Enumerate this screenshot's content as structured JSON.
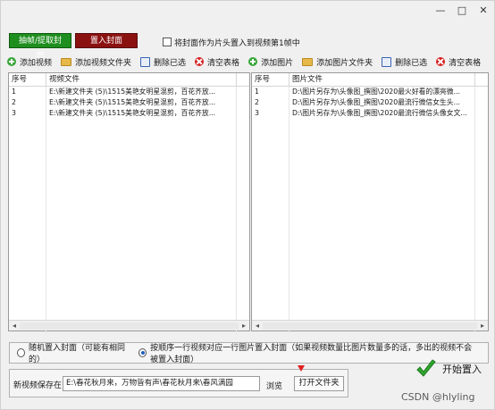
{
  "window": {
    "controls": {
      "minimize": "—",
      "maximize": "□",
      "close": "✕"
    }
  },
  "tabs": {
    "extract": "抽帧/提取封面",
    "place": "置入封面"
  },
  "options": {
    "first_frame_checkbox": "将封面作为片头置入到视频第1帧中"
  },
  "toolbar": {
    "left": [
      {
        "label": "添加视频",
        "icon": "add-icon"
      },
      {
        "label": "添加视频文件夹",
        "icon": "folder-icon"
      },
      {
        "label": "删除已选",
        "icon": "delete-icon"
      },
      {
        "label": "清空表格",
        "icon": "clear-icon"
      }
    ],
    "right": [
      {
        "label": "添加图片",
        "icon": "add-icon"
      },
      {
        "label": "添加图片文件夹",
        "icon": "folder-icon"
      },
      {
        "label": "删除已选",
        "icon": "delete-icon"
      },
      {
        "label": "清空表格",
        "icon": "clear-icon"
      }
    ]
  },
  "video_table": {
    "headers": {
      "no": "序号",
      "file": "视频文件"
    },
    "rows": [
      {
        "no": "1",
        "file": "E:\\新建文件夹 (5)\\1515美艳女明星混剪，百花齐放..."
      },
      {
        "no": "2",
        "file": "E:\\新建文件夹 (5)\\1515美艳女明星混剪，百花齐放..."
      },
      {
        "no": "3",
        "file": "E:\\新建文件夹 (5)\\1515美艳女明星混剪，百花齐放..."
      }
    ]
  },
  "image_table": {
    "headers": {
      "no": "序号",
      "file": "图片文件"
    },
    "rows": [
      {
        "no": "1",
        "file": "D:\\图片另存为\\头像图_撰图\\2020最火好看的漂亮微..."
      },
      {
        "no": "2",
        "file": "D:\\图片另存为\\头像图_撰图\\2020最流行微信女生头..."
      },
      {
        "no": "3",
        "file": "D:\\图片另存为\\头像图_撰图\\2020最流行微信头像女文..."
      }
    ]
  },
  "mode": {
    "random": "随机置入封面（可能有相同的）",
    "sequential": "按顺序一行视频对应一行图片置入封面（如果视频数量比图片数量多的话，多出的视频不会被置入封面）",
    "selected": "sequential"
  },
  "save": {
    "label": "新视频保存在:",
    "path": "E:\\春花秋月来，万物皆有声\\春花秋月来\\春风满园",
    "browse": "浏览",
    "open_folder": "打开文件夹"
  },
  "start": {
    "label": "开始置入"
  },
  "watermark": "CSDN @hlyling",
  "colors": {
    "extract_tab": "#1e8e1e",
    "place_tab": "#8b1111",
    "start_check": "#2fa52f",
    "red_arrow": "#e02020"
  }
}
